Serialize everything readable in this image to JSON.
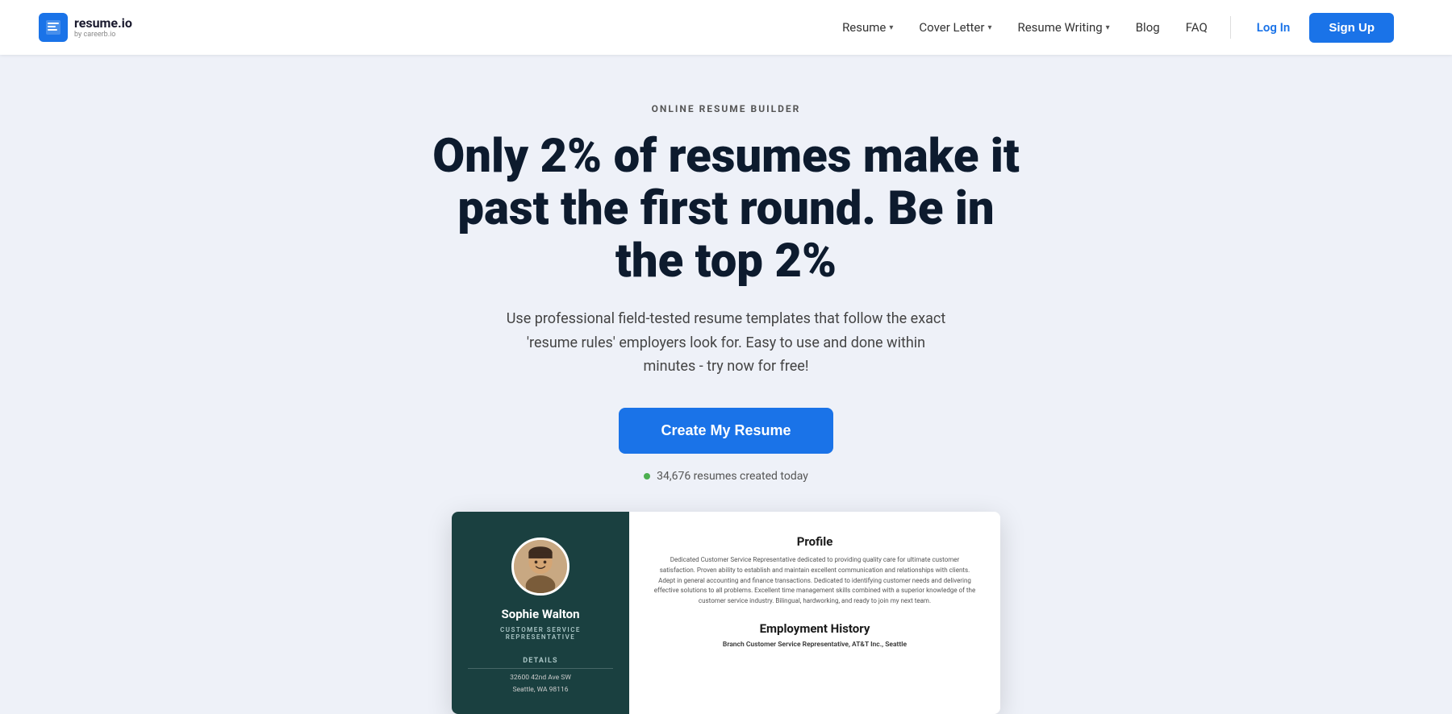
{
  "nav": {
    "logo_main": "resume.io",
    "logo_sub": "by careerb.io",
    "links": [
      {
        "label": "Resume",
        "has_dropdown": true
      },
      {
        "label": "Cover Letter",
        "has_dropdown": true
      },
      {
        "label": "Resume Writing",
        "has_dropdown": true
      },
      {
        "label": "Blog",
        "has_dropdown": false
      },
      {
        "label": "FAQ",
        "has_dropdown": false
      }
    ],
    "login": "Log In",
    "signup": "Sign Up"
  },
  "hero": {
    "eyebrow": "ONLINE RESUME BUILDER",
    "title": "Only 2% of resumes make it past the first round. Be in the top 2%",
    "subtitle": "Use professional field-tested resume templates that follow the exact 'resume rules' employers look for. Easy to use and done within minutes - try now for free!",
    "cta": "Create My Resume",
    "stats": "34,676 resumes created today"
  },
  "resume": {
    "left": {
      "name": "Sophie Walton",
      "job_title": "CUSTOMER SERVICE\nREPRESENTATIVE",
      "details_label": "Details",
      "address1": "32600 42nd Ave SW",
      "address2": "Seattle, WA 98116"
    },
    "right": {
      "profile_label": "Profile",
      "profile_text": "Dedicated Customer Service Representative dedicated to providing quality care for ultimate customer satisfaction. Proven ability to establish and maintain excellent communication and relationships with clients. Adept in general accounting and finance transactions. Dedicated to identifying customer needs and delivering effective solutions to all problems. Excellent time management skills combined with a superior knowledge of the customer service industry. Bilingual, hardworking, and ready to join my next team.",
      "employment_label": "Employment History",
      "employment_entry": "Branch Customer Service Representative, AT&T Inc., Seattle"
    }
  },
  "colors": {
    "primary": "#1a73e8",
    "resume_dark": "#1a4040",
    "background": "#eef1f8"
  }
}
